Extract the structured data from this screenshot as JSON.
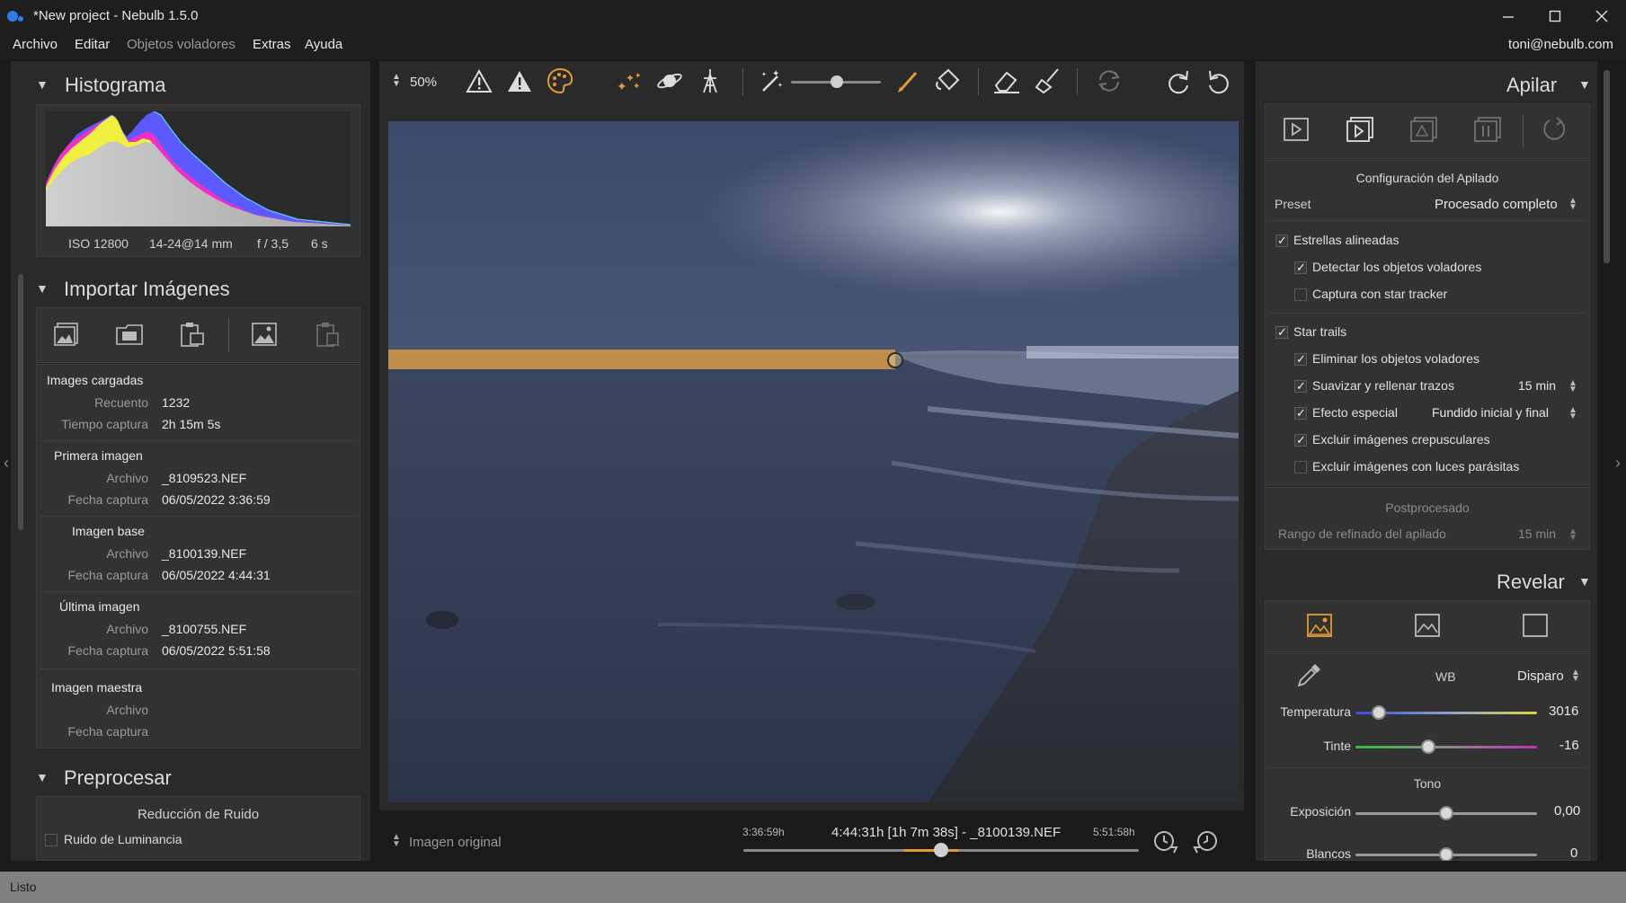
{
  "window": {
    "title": "*New project - Nebulb 1.5.0",
    "minimize_icon": "minimize-icon",
    "maximize_icon": "maximize-icon",
    "close_icon": "close-icon"
  },
  "menu": {
    "items": [
      "Archivo",
      "Editar",
      "Objetos voladores",
      "Extras",
      "Ayuda"
    ],
    "user_email": "toni@nebulb.com"
  },
  "left_panel": {
    "histogram": {
      "title": "Histograma",
      "iso": "ISO 12800",
      "lens": "14-24@14 mm",
      "aperture": "f / 3,5",
      "exposure": "6 s"
    },
    "import": {
      "title": "Importar Imágenes",
      "loaded": {
        "title": "Images cargadas",
        "count_label": "Recuento",
        "count_value": "1232",
        "time_label": "Tiempo captura",
        "time_value": "2h 15m 5s"
      },
      "first": {
        "title": "Primera imagen",
        "file_label": "Archivo",
        "file_value": "_8109523.NEF",
        "date_label": "Fecha captura",
        "date_value": "06/05/2022 3:36:59"
      },
      "base": {
        "title": "Imagen base",
        "file_label": "Archivo",
        "file_value": "_8100139.NEF",
        "date_label": "Fecha captura",
        "date_value": "06/05/2022 4:44:31"
      },
      "last": {
        "title": "Última imagen",
        "file_label": "Archivo",
        "file_value": "_8100755.NEF",
        "date_label": "Fecha captura",
        "date_value": "06/05/2022 5:51:58"
      },
      "master": {
        "title": "Imagen maestra",
        "file_label": "Archivo",
        "date_label": "Fecha captura"
      }
    },
    "preprocess": {
      "title": "Preprocesar",
      "noise_title": "Reducción de Ruido",
      "luminance_noise": "Ruido de Luminancia"
    }
  },
  "toolbar": {
    "zoom": "50%"
  },
  "bottom_bar": {
    "view_mode": "Imagen original",
    "time_start": "3:36:59h",
    "time_end": "5:51:58h",
    "current_frame": "4:44:31h [1h 7m 38s] - _8100139.NEF",
    "timeline_position": 0.5
  },
  "right_panel": {
    "stack": {
      "title": "Apilar",
      "config_title": "Configuración del Apilado",
      "preset_label": "Preset",
      "preset_value": "Procesado completo",
      "aligned_stars": "Estrellas alineadas",
      "detect_flying": "Detectar los objetos voladores",
      "star_tracker": "Captura con star tracker",
      "star_trails": "Star trails",
      "remove_flying": "Eliminar los objetos voladores",
      "smooth_fill": "Suavizar y rellenar trazos",
      "smooth_value": "15 min",
      "special_effect": "Efecto especial",
      "special_value": "Fundido inicial y final",
      "exclude_twilight": "Excluir imágenes crepusculares",
      "exclude_lights": "Excluir imágenes con luces parásitas",
      "post_title": "Postprocesado",
      "refine_label": "Rango de refinado del apilado",
      "refine_value": "15 min"
    },
    "develop": {
      "title": "Revelar",
      "wb_label": "WB",
      "wb_value": "Disparo",
      "temp_label": "Temperatura",
      "temp_value": "3016",
      "temp_position": 0.13,
      "tint_label": "Tinte",
      "tint_value": "-16",
      "tint_position": 0.4,
      "tone_title": "Tono",
      "exposure_label": "Exposición",
      "exposure_value": "0,00",
      "exposure_position": 0.5,
      "whites_label": "Blancos",
      "whites_value": "0",
      "whites_position": 0.5
    }
  },
  "status": {
    "text": "Listo"
  },
  "colors": {
    "accent_orange": "#e29a34",
    "panel_bg": "#2a2a2a",
    "app_bg": "#1a1a1a"
  }
}
